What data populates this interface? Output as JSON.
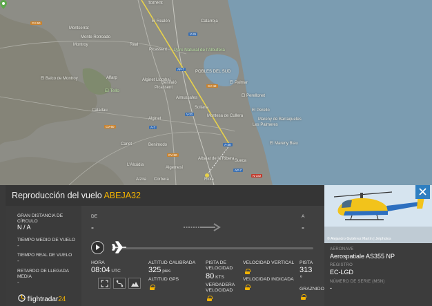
{
  "map": {
    "places": [
      {
        "name": "Torrent",
        "cls": "big"
      },
      {
        "name": "El Realón",
        "cls": ""
      },
      {
        "name": "Catarroja",
        "cls": ""
      },
      {
        "name": "Montserrat",
        "cls": ""
      },
      {
        "name": "Monte Rotroado",
        "cls": ""
      },
      {
        "name": "Montroy",
        "cls": ""
      },
      {
        "name": "Real",
        "cls": ""
      },
      {
        "name": "Picassent",
        "cls": ""
      },
      {
        "name": "Parc Natural de l'Albufera",
        "cls": "green"
      },
      {
        "name": "POBLES DEL SUD",
        "cls": ""
      },
      {
        "name": "El Balco de Montroy",
        "cls": ""
      },
      {
        "name": "Alfarp",
        "cls": ""
      },
      {
        "name": "Alginet Llombai",
        "cls": ""
      },
      {
        "name": "Benifaió",
        "cls": ""
      },
      {
        "name": "Picassent",
        "cls": ""
      },
      {
        "name": "El Palmar",
        "cls": ""
      },
      {
        "name": "El Perellonet",
        "cls": ""
      },
      {
        "name": "El Tello",
        "cls": "green"
      },
      {
        "name": "Almussafes",
        "cls": ""
      },
      {
        "name": "Catadau",
        "cls": ""
      },
      {
        "name": "Sollana",
        "cls": ""
      },
      {
        "name": "El Perello",
        "cls": ""
      },
      {
        "name": "Montesa de Cullera",
        "cls": ""
      },
      {
        "name": "Mareny de Barraquetes",
        "cls": ""
      },
      {
        "name": "Alginet",
        "cls": ""
      },
      {
        "name": "Les Palmeres",
        "cls": ""
      },
      {
        "name": "Carlet",
        "cls": ""
      },
      {
        "name": "Benimodo",
        "cls": ""
      },
      {
        "name": "El Mareny Blau",
        "cls": ""
      },
      {
        "name": "Albalat de la Ribera",
        "cls": ""
      },
      {
        "name": "L'Alcúdia",
        "cls": ""
      },
      {
        "name": "Algemesí",
        "cls": ""
      },
      {
        "name": "Sueca",
        "cls": ""
      },
      {
        "name": "Alzira",
        "cls": ""
      },
      {
        "name": "Corbera",
        "cls": ""
      },
      {
        "name": "Riola",
        "cls": ""
      }
    ],
    "shields": [
      {
        "code": "CV-50",
        "cls": "orange"
      },
      {
        "code": "V-31",
        "cls": ""
      },
      {
        "code": "AP-7",
        "cls": ""
      },
      {
        "code": "CV-42",
        "cls": "orange"
      },
      {
        "code": "A-7",
        "cls": ""
      },
      {
        "code": "V-31",
        "cls": ""
      },
      {
        "code": "CV-50",
        "cls": "orange"
      },
      {
        "code": "A-38",
        "cls": ""
      },
      {
        "code": "N-332",
        "cls": "red"
      },
      {
        "code": "CV-50",
        "cls": "orange"
      },
      {
        "code": "AP-7",
        "cls": ""
      }
    ]
  },
  "panel": {
    "title_prefix": "Reproducción del vuelo",
    "callsign": "ABEJA32",
    "stats": [
      {
        "label": "GRAN DISTANCIA DE CÍRCULO",
        "value": "N / A",
        "strong": true
      },
      {
        "label": "TIEMPO MEDIO DE VUELO",
        "value": "-",
        "strong": false
      },
      {
        "label": "TIEMPO REAL DE VUELO",
        "value": "-",
        "strong": false
      },
      {
        "label": "RETARDO DE LLEGADA MEDIA",
        "value": "-",
        "strong": false
      }
    ],
    "from_label": "DE",
    "from_value": "-",
    "to_label": "A",
    "to_value": "-",
    "hora_label": "HORA",
    "hora_value": "08:04",
    "hora_unit": "UTC",
    "alt_cal_label": "ALTITUD CALIBRADA",
    "alt_cal_value": "325",
    "alt_cal_unit": "pies",
    "alt_gps_label": "ALTITUD GPS",
    "ground_speed_label": "PISTA DE VELOCIDAD",
    "ground_speed_value": "80",
    "ground_speed_unit": "KTS",
    "true_speed_label": "VERDADERA VELOCIDAD",
    "vert_speed_label": "VELOCIDAD VERTICAL",
    "ind_speed_label": "VELOCIDAD INDICADA",
    "track_label": "PISTA",
    "track_value": "313",
    "track_unit": "º",
    "squawk_label": "GRAZNIDO",
    "logo_text": "flightradar",
    "logo_num": "24"
  },
  "aircraft": {
    "photo_credit": "© Alejandro Gutiérrez Martín | Jetphotos",
    "aircraft_label": "AERONAVE",
    "aircraft_value": "Aerospatiale AS355 NP",
    "reg_label": "REGISTRO",
    "reg_value": "EC-LGD",
    "msn_label": "NÚMERO DE SERIE (MSN)",
    "msn_value": "-"
  },
  "colors": {
    "accent": "#f4b400",
    "close": "#2f7fc1",
    "sea": "#7a9db3",
    "land": "#8d8d86"
  },
  "icons": [
    "close-icon",
    "play-icon",
    "plane-icon",
    "lock-icon",
    "expand-icon",
    "route-icon",
    "chart-icon",
    "arrow-right-icon",
    "map-pin-icon"
  ]
}
